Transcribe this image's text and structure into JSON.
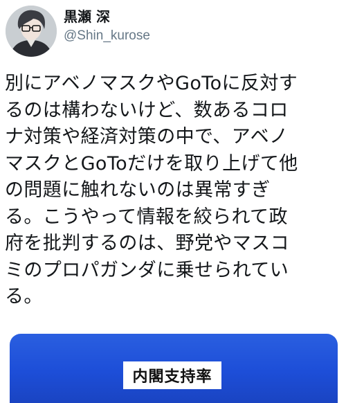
{
  "user": {
    "display_name": "黒瀬 深",
    "handle": "@Shin_kurose",
    "avatar_icon": "avatar-image-icon"
  },
  "tweet": {
    "lines": [
      "別にアベノマスクやGoToに反対す",
      "るのは構わないけど、数あるコロ",
      "ナ対策や経済対策の中で、アベノ",
      "マスクとGoToだけを取り上げて他",
      "の問題に触れないのは異常すぎ",
      "る。こうやって情報を絞られて政",
      "府を批判するのは、野党やマスコ",
      "ミのプロパガンダに乗せられてい",
      "る。"
    ]
  },
  "media": {
    "title": "内閣支持率",
    "background_color": "#1d4ed8"
  },
  "colors": {
    "text": "#14171a",
    "secondary_text": "#657786",
    "media_blue": "#1d4ed8"
  }
}
